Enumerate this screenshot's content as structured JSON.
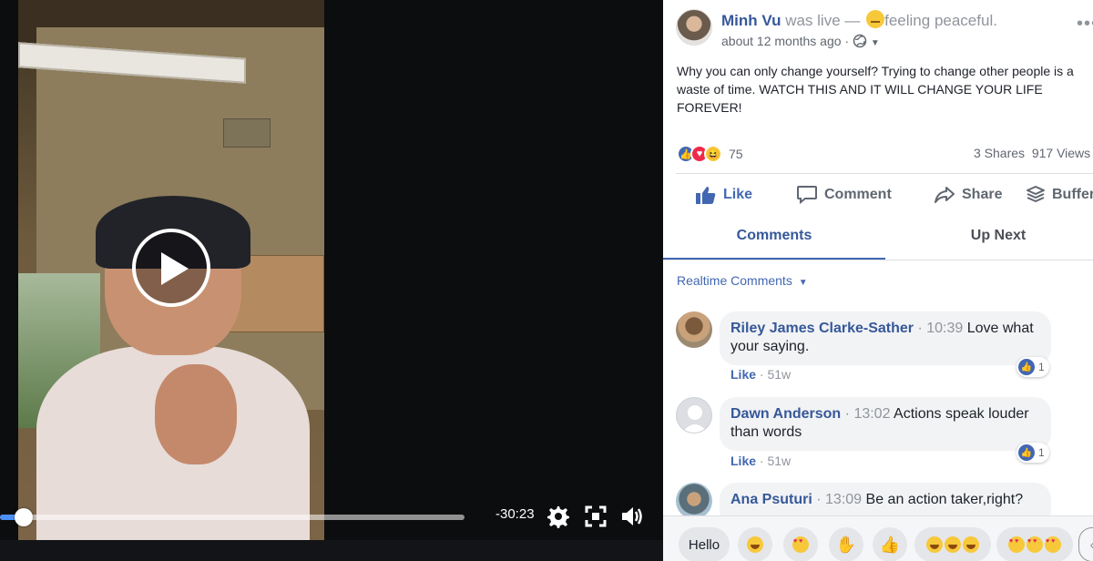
{
  "video": {
    "time_remaining": "-30:23",
    "progress_fraction": 0.05,
    "controls": {
      "settings_icon": "gear-icon",
      "fullscreen_icon": "expand-icon",
      "volume_icon": "volume-icon"
    }
  },
  "post": {
    "author": "Minh Vu",
    "status": "was live —",
    "feeling": "feeling peaceful.",
    "time": "about 12 months ago",
    "privacy_separator": "·",
    "text": "Why you can only change yourself? Trying to change other people is a waste of time. WATCH THIS AND IT WILL CHANGE YOUR LIFE FOREVER!",
    "reaction_count": "75",
    "shares": "3 Shares",
    "views": "917 Views"
  },
  "actions": {
    "like": "Like",
    "comment": "Comment",
    "share": "Share",
    "buffer": "Buffer"
  },
  "tabs": {
    "comments": "Comments",
    "up_next": "Up Next"
  },
  "realtime_label": "Realtime Comments",
  "comments": [
    {
      "name": "Riley James Clarke-Sather",
      "time": "10:39",
      "text": "Love what your saying.",
      "like_label": "Like",
      "age": "51w",
      "likes": "1"
    },
    {
      "name": "Dawn Anderson",
      "time": "13:02",
      "text": "Actions speak louder than words",
      "like_label": "Like",
      "age": "51w",
      "likes": "1"
    },
    {
      "name": "Ana Psuturi",
      "time": "13:09",
      "text": "Be an action taker,right?"
    }
  ],
  "quick_replies": {
    "hello": "Hello"
  },
  "colors": {
    "link_blue": "#365899",
    "accent_blue": "#4267b2",
    "progress_blue": "#4b8ff7"
  }
}
